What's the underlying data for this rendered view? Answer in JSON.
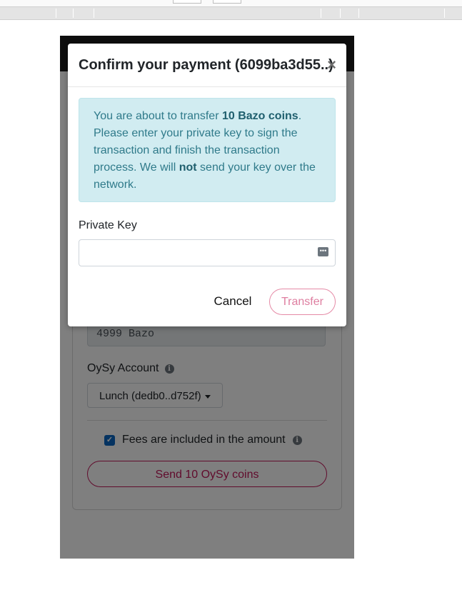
{
  "modal": {
    "title": "Confirm your payment (6099ba3d55..)",
    "close_label": "×",
    "alert_part1": "You are about to transfer ",
    "alert_amount": "10 Bazo coins",
    "alert_part2": ". Please enter your private key to sign the transaction and finish the transaction process. We will ",
    "alert_emphasis": "not",
    "alert_part3": " send your key over the network.",
    "private_key_label": "Private Key",
    "private_key_value": "",
    "cancel_label": "Cancel",
    "transfer_label": "Transfer"
  },
  "form": {
    "balance_value": "4999 Bazo",
    "account_label": "OySy Account",
    "account_selected": "Lunch (dedb0..d752f)",
    "fees_label": "Fees are included in the amount",
    "fees_checked": true,
    "send_button": "Send 10 OySy coins"
  },
  "colors": {
    "accent": "#c2185b",
    "info_bg": "#d1ecf1",
    "checkbox": "#0a66c2"
  },
  "icons": {
    "info": "info-circle-icon",
    "key": "password-manager-icon",
    "close": "close-icon",
    "caret": "caret-down-icon",
    "check": "check-icon"
  }
}
